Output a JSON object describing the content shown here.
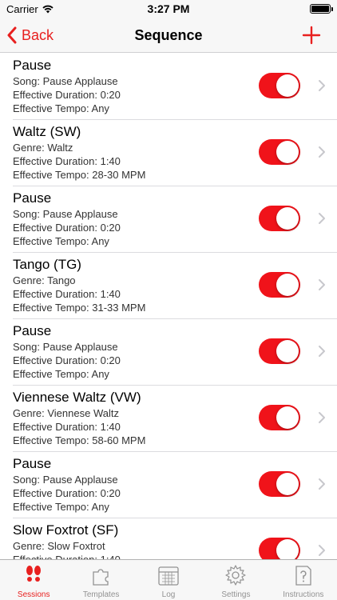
{
  "status_bar": {
    "carrier": "Carrier",
    "time": "3:27 PM"
  },
  "nav": {
    "back_label": "Back",
    "title": "Sequence",
    "add_icon": "plus-icon"
  },
  "colors": {
    "accent": "#e8201f",
    "toggle_on": "#f0131a",
    "tab_inactive": "#929292"
  },
  "items": [
    {
      "title": "Pause",
      "line1": "Song: Pause Applause",
      "line2": "Effective Duration: 0:20",
      "line3": "Effective Tempo: Any",
      "enabled": true
    },
    {
      "title": "Waltz (SW)",
      "line1": "Genre: Waltz",
      "line2": "Effective Duration: 1:40",
      "line3": "Effective Tempo: 28-30 MPM",
      "enabled": true
    },
    {
      "title": "Pause",
      "line1": "Song: Pause Applause",
      "line2": "Effective Duration: 0:20",
      "line3": "Effective Tempo: Any",
      "enabled": true
    },
    {
      "title": "Tango (TG)",
      "line1": "Genre: Tango",
      "line2": "Effective Duration: 1:40",
      "line3": "Effective Tempo: 31-33 MPM",
      "enabled": true
    },
    {
      "title": "Pause",
      "line1": "Song: Pause Applause",
      "line2": "Effective Duration: 0:20",
      "line3": "Effective Tempo: Any",
      "enabled": true
    },
    {
      "title": "Viennese Waltz (VW)",
      "line1": "Genre: Viennese Waltz",
      "line2": "Effective Duration: 1:40",
      "line3": "Effective Tempo: 58-60 MPM",
      "enabled": true
    },
    {
      "title": "Pause",
      "line1": "Song: Pause Applause",
      "line2": "Effective Duration: 0:20",
      "line3": "Effective Tempo: Any",
      "enabled": true
    },
    {
      "title": "Slow Foxtrot (SF)",
      "line1": "Genre: Slow Foxtrot",
      "line2": "Effective Duration: 1:40",
      "line3": "",
      "enabled": true
    }
  ],
  "tabs": [
    {
      "label": "Sessions",
      "icon": "footprints-icon",
      "active": true
    },
    {
      "label": "Templates",
      "icon": "puzzle-icon",
      "active": false
    },
    {
      "label": "Log",
      "icon": "calendar-icon",
      "active": false
    },
    {
      "label": "Settings",
      "icon": "gear-icon",
      "active": false
    },
    {
      "label": "Instructions",
      "icon": "question-icon",
      "active": false
    }
  ]
}
